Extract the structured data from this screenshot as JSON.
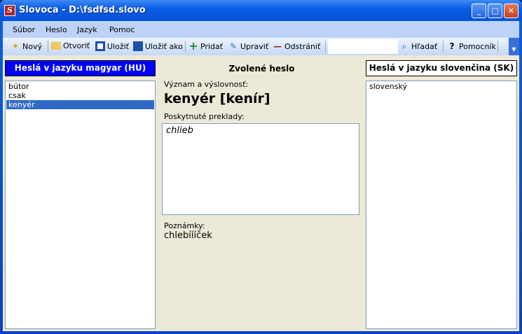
{
  "window": {
    "title": "Slovoca - D:\\fsdfsd.slovo",
    "app_icon": "S",
    "buttons": {
      "minimize": "_",
      "maximize": "□",
      "close": "✕"
    }
  },
  "menu": [
    "Súbor",
    "Heslo",
    "Jazyk",
    "Pomoc"
  ],
  "toolbar": {
    "new": "Nový",
    "open": "Otvoriť",
    "save": "Uložiť",
    "save_as": "Uložiť ako",
    "add": "Pridať",
    "edit": "Upraviť",
    "remove": "Odstrániť",
    "search_value": "",
    "find": "Hľadať",
    "helper": "Pomocník"
  },
  "left": {
    "header": "Heslá v jazyku magyar (HU)",
    "items": [
      "bútor",
      "csak",
      "kenyér"
    ],
    "selected": "kenyér"
  },
  "middle": {
    "header": "Zvolené heslo",
    "meaning_label": "Význam a výslovnosť:",
    "word": "kenyér [kenír]",
    "translations_label": "Poskytnuté preklady:",
    "translations": "chlieb",
    "notes_label": "Poznámky:",
    "notes": "chlebíííček"
  },
  "right": {
    "header": "Heslá v jazyku slovenčina (SK)",
    "items": [
      "slovenský"
    ]
  },
  "colors": {
    "left_header": "#0000ff",
    "selection": "#316ac5",
    "background": "#ece9d8"
  }
}
